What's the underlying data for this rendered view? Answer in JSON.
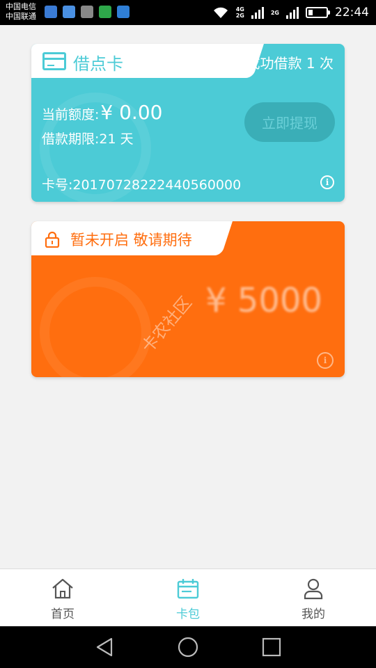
{
  "status_bar": {
    "carrier_1": "中国电信",
    "carrier_2": "中国联通",
    "network_1": "4G",
    "network_2": "2G",
    "network_3": "2G",
    "time": "22:44"
  },
  "card_borrow": {
    "title": "借点卡",
    "borrow_count": "成功借款 1 次",
    "quota_label": "当前额度:",
    "quota_amount": "¥ 0.00",
    "term": "借款期限:21 天",
    "withdraw_label": "立即提现",
    "card_number": "卡号:20170728222440560000",
    "accent_color": "#4ccbd6"
  },
  "card_locked": {
    "title": "暂未开启 敬请期待",
    "amount": "¥ 5000",
    "watermark": "卡农社区",
    "accent_color": "#ff6e0f"
  },
  "bottom_nav": {
    "items": [
      {
        "label": "首页",
        "icon": "home-icon"
      },
      {
        "label": "卡包",
        "icon": "card-wallet-icon",
        "active": true
      },
      {
        "label": "我的",
        "icon": "user-icon"
      }
    ]
  },
  "system_nav": {
    "icons": [
      "back-icon",
      "home-circle-icon",
      "recents-icon"
    ]
  }
}
